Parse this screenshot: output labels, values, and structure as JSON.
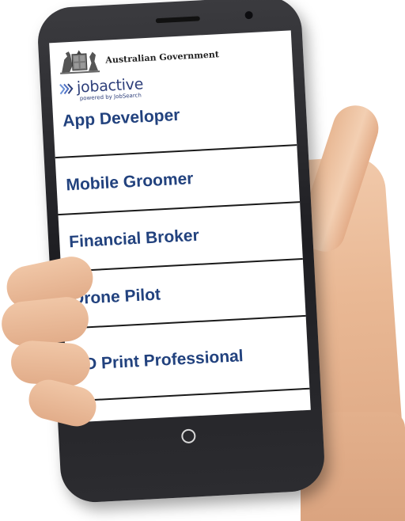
{
  "header": {
    "government": "Australian Government",
    "brand": "jobactive",
    "brand_tagline": "powered by JobSearch"
  },
  "jobs": [
    {
      "label": "App Developer"
    },
    {
      "label": "Mobile Groomer"
    },
    {
      "label": "Financial Broker"
    },
    {
      "label": "Drone Pilot"
    },
    {
      "label": "3D Print Professional"
    }
  ],
  "colors": {
    "job_text": "#22427e",
    "brand": "#2e3f7a",
    "divider": "#1a1a1a"
  },
  "icons": {
    "crest": "coat-of-arms-icon",
    "brand_mark": "chevrons-icon",
    "home": "home-button-icon"
  }
}
